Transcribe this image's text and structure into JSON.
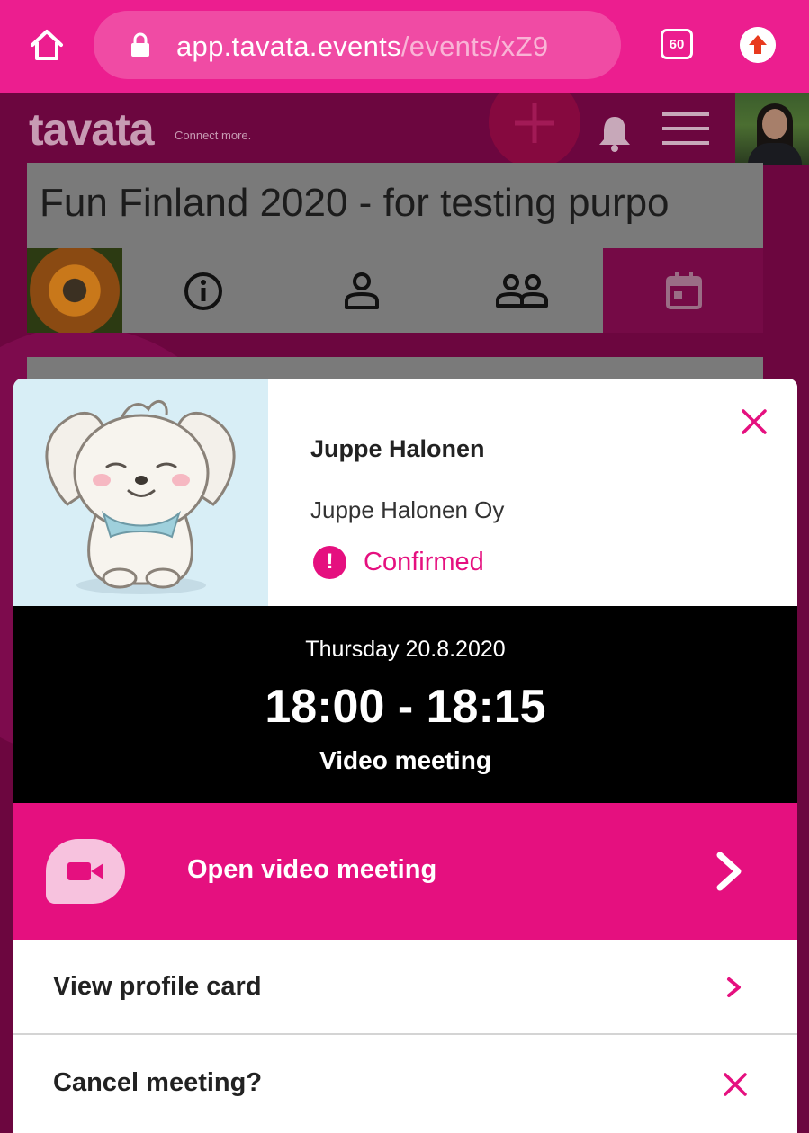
{
  "browser": {
    "url_main": "app.tavata.events",
    "url_path": "/events/xZ9",
    "tab_count": "60"
  },
  "app": {
    "logo": "tavata",
    "tagline": "Connect more.",
    "event_title": "Fun Finland 2020 - for testing purpo"
  },
  "modal": {
    "person_name": "Juppe Halonen",
    "company": "Juppe Halonen Oy",
    "status_icon": "!",
    "status": "Confirmed",
    "date": "Thursday 20.8.2020",
    "time": "18:00 - 18:15",
    "meeting_type": "Video meeting",
    "open_video_label": "Open video meeting",
    "view_profile_label": "View profile card",
    "cancel_label": "Cancel meeting?"
  },
  "colors": {
    "brand": "#e5107f",
    "overlay": "#6c063f",
    "time_block": "#000000"
  },
  "icons": [
    "home-icon",
    "lock-icon",
    "tab-count-icon",
    "update-icon",
    "plus-icon",
    "bell-icon",
    "menu-icon",
    "info-icon",
    "person-icon",
    "people-icon",
    "calendar-icon",
    "close-icon",
    "alert-icon",
    "video-camera-icon",
    "chevron-right-icon"
  ]
}
